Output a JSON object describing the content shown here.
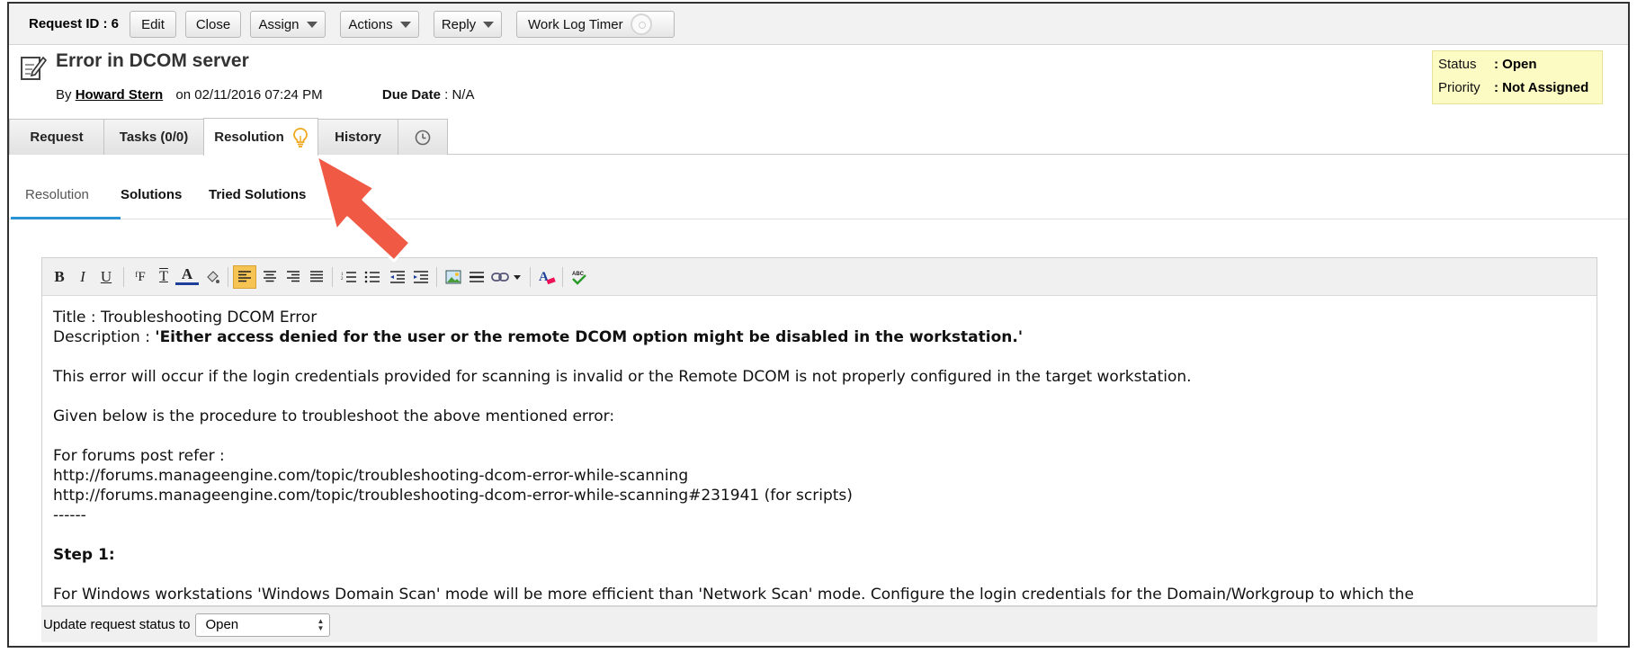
{
  "toolbar": {
    "request_id": "Request ID : 6",
    "buttons": {
      "edit": "Edit",
      "close": "Close",
      "assign": "Assign",
      "actions": "Actions",
      "reply": "Reply",
      "work_log_timer": "Work Log Timer"
    }
  },
  "request": {
    "title": "Error in DCOM server",
    "by_label": "By",
    "author": "Howard Stern",
    "on_label": "on",
    "date": "02/11/2016 07:24 PM",
    "due_label": "Due Date",
    "due_value": ": N/A"
  },
  "status_box": {
    "status_label": "Status",
    "status_value": ": Open",
    "priority_label": "Priority",
    "priority_value": ": Not Assigned"
  },
  "tabs": {
    "request": "Request",
    "tasks": "Tasks (0/0)",
    "resolution": "Resolution",
    "history": "History"
  },
  "subtabs": {
    "resolution": "Resolution",
    "solutions": "Solutions",
    "tried_solutions": "Tried Solutions"
  },
  "editor": {
    "content": {
      "title_line": "Title : Troubleshooting DCOM Error",
      "description_label": "Description : ",
      "description_text": "'Either access denied for the user or the remote DCOM option might be disabled in the workstation.'",
      "para1": "This error will occur if the login credentials provided for scanning is invalid or the Remote DCOM is not properly configured in the target workstation.",
      "para2": "Given below is the procedure to troubleshoot the above mentioned error:",
      "forums_label": "For forums post refer :",
      "link1": "http://forums.manageengine.com/topic/troubleshooting-dcom-error-while-scanning",
      "link2": "http://forums.manageengine.com/topic/troubleshooting-dcom-error-while-scanning#231941 (for scripts)",
      "divider": "------",
      "step1": "Step 1:",
      "para3": "For Windows workstations 'Windows Domain Scan' mode will be more efficient than 'Network Scan' mode. Configure the login credentials for the Domain/Workgroup to which the"
    }
  },
  "status_update": {
    "label": "Update request status to",
    "selected": "Open"
  },
  "colors": {
    "active_underline": "#2a93d5",
    "status_box_bg": "#fdfbc4",
    "annotation_arrow": "#f05a45",
    "bulb_icon": "#f0a81c"
  },
  "icons": [
    "request-edit-icon",
    "bulb-icon",
    "clock-icon",
    "caret-down-icon",
    "timer-toggle-icon",
    "annotation-arrow"
  ]
}
